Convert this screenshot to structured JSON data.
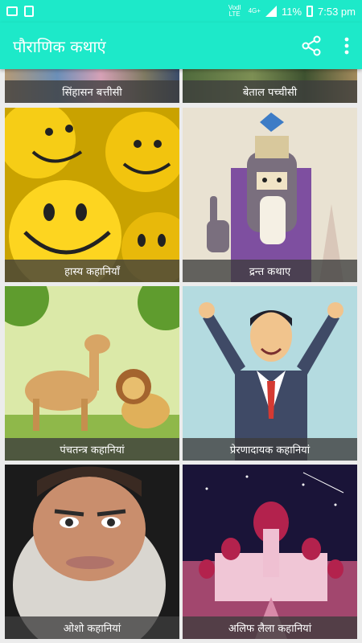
{
  "status": {
    "carrier": "Vodl LTE",
    "network": "4G+",
    "battery": "11%",
    "time": "7:53 pm"
  },
  "app": {
    "title": "पौराणिक कथाएं",
    "share_icon": "share-icon",
    "more_icon": "more-vert-icon",
    "accent": "#1de9c9"
  },
  "cards": [
    {
      "label": "सिंहासन बत्तीसी"
    },
    {
      "label": "बेताल पच्चीसी"
    },
    {
      "label": "हास्य कहानियाँ"
    },
    {
      "label": "द्रन्त कथाए"
    },
    {
      "label": "पंचतन्त्र कहानियां"
    },
    {
      "label": "प्रेरणादायक कहानियां"
    },
    {
      "label": "ओशो कहानियां"
    },
    {
      "label": "अलिफ लैला कहानियां"
    }
  ]
}
